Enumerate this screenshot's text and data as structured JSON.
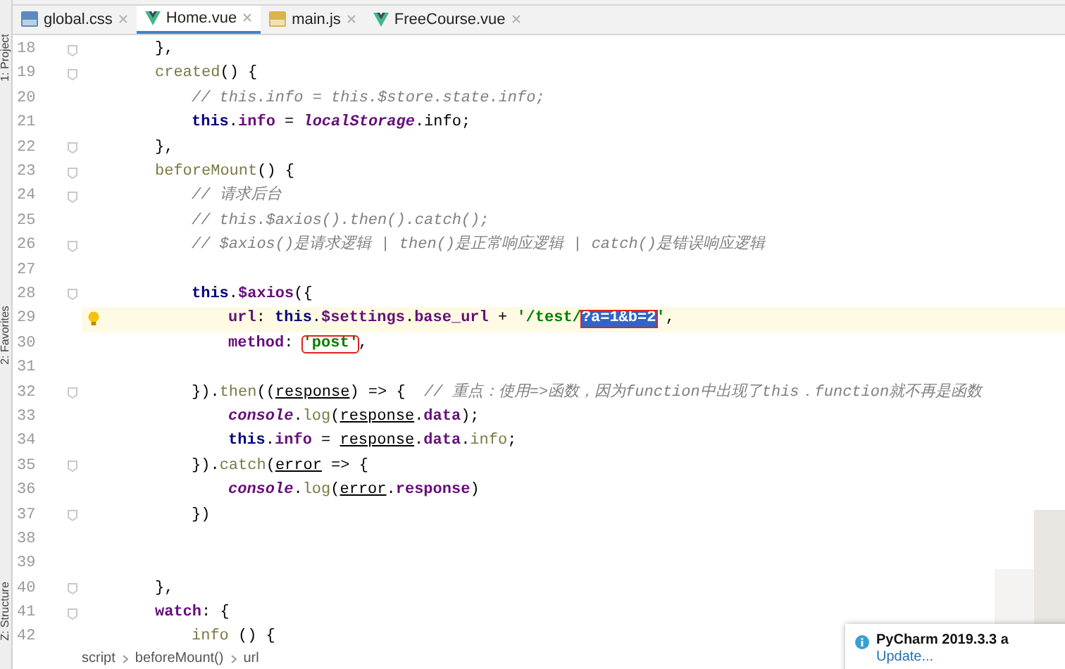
{
  "side_strip": {
    "labels": [
      "1: Project",
      "2: Favorites",
      "Z: Structure"
    ]
  },
  "tabs": [
    {
      "label": "global.css",
      "kind": "css",
      "selected": false
    },
    {
      "label": "Home.vue",
      "kind": "vue",
      "selected": true
    },
    {
      "label": "main.js",
      "kind": "js",
      "selected": false
    },
    {
      "label": "FreeCourse.vue",
      "kind": "vue",
      "selected": false
    }
  ],
  "code_lines": [
    {
      "number": "18",
      "kind": "member",
      "fold": true,
      "current": false,
      "bulb": false,
      "tokens": [
        {
          "text": "},",
          "kind": "plain"
        }
      ]
    },
    {
      "number": "19",
      "kind": "member",
      "fold": true,
      "current": false,
      "bulb": false,
      "tokens": [
        {
          "text": "created",
          "kind": "fn"
        },
        {
          "text": "() {",
          "kind": "plain"
        }
      ]
    },
    {
      "number": "20",
      "kind": "body",
      "fold": false,
      "current": false,
      "bulb": false,
      "tokens": [
        {
          "text": "// this.info = this.$store.state.info;",
          "kind": "comment"
        }
      ]
    },
    {
      "number": "21",
      "kind": "body",
      "fold": false,
      "current": false,
      "bulb": false,
      "tokens": [
        {
          "text": "this",
          "kind": "kw"
        },
        {
          "text": ".",
          "kind": "plain"
        },
        {
          "text": "info",
          "kind": "prop"
        },
        {
          "text": " = ",
          "kind": "plain"
        },
        {
          "text": "localStorage",
          "kind": "global"
        },
        {
          "text": ".info;",
          "kind": "plain"
        }
      ]
    },
    {
      "number": "22",
      "kind": "member",
      "fold": true,
      "current": false,
      "bulb": false,
      "tokens": [
        {
          "text": "},",
          "kind": "plain"
        }
      ]
    },
    {
      "number": "23",
      "kind": "member",
      "fold": true,
      "current": false,
      "bulb": false,
      "tokens": [
        {
          "text": "beforeMount",
          "kind": "fn"
        },
        {
          "text": "() {",
          "kind": "plain"
        }
      ]
    },
    {
      "number": "24",
      "kind": "body",
      "fold": true,
      "current": false,
      "bulb": false,
      "tokens": [
        {
          "text": "// 请求后台",
          "kind": "comment"
        }
      ]
    },
    {
      "number": "25",
      "kind": "body",
      "fold": false,
      "current": false,
      "bulb": false,
      "tokens": [
        {
          "text": "// this.$axios().then().catch();",
          "kind": "comment"
        }
      ]
    },
    {
      "number": "26",
      "kind": "body",
      "fold": true,
      "current": false,
      "bulb": false,
      "tokens": [
        {
          "text": "// $axios()是请求逻辑 | then()是正常响应逻辑 | catch()是错误响应逻辑",
          "kind": "comment"
        }
      ]
    },
    {
      "number": "27",
      "kind": "body",
      "fold": false,
      "current": false,
      "bulb": false
    },
    {
      "number": "28",
      "kind": "body",
      "fold": true,
      "current": false,
      "bulb": false,
      "tokens": [
        {
          "text": "this",
          "kind": "kw"
        },
        {
          "text": ".",
          "kind": "plain"
        },
        {
          "text": "$axios",
          "kind": "prop"
        },
        {
          "text": "({",
          "kind": "plain"
        }
      ]
    },
    {
      "number": "29",
      "kind": "inner",
      "fold": false,
      "current": true,
      "bulb": true,
      "tokens": [
        {
          "text": "url",
          "kind": "prop"
        },
        {
          "text": ": ",
          "kind": "plain"
        },
        {
          "text": "this",
          "kind": "kw"
        },
        {
          "text": ".",
          "kind": "plain"
        },
        {
          "text": "$settings",
          "kind": "prop"
        },
        {
          "text": ".",
          "kind": "plain"
        },
        {
          "text": "base_url",
          "kind": "prop"
        },
        {
          "text": " + ",
          "kind": "plain"
        },
        {
          "text": "'/test/",
          "kind": "str"
        },
        {
          "text": "?a=1&b=2",
          "kind": "selected"
        },
        {
          "text": "'",
          "kind": "str"
        },
        {
          "text": ",",
          "kind": "plain"
        }
      ]
    },
    {
      "number": "30",
      "kind": "inner",
      "fold": false,
      "current": false,
      "bulb": false,
      "tokens": [
        {
          "text": "method",
          "kind": "prop"
        },
        {
          "text": ": ",
          "kind": "plain"
        },
        {
          "text": "'post'",
          "kind": "boxed"
        },
        {
          "text": ",",
          "kind": "plain"
        }
      ]
    },
    {
      "number": "31",
      "kind": "body",
      "fold": false,
      "current": false,
      "bulb": false
    },
    {
      "number": "32",
      "kind": "body",
      "fold": true,
      "current": false,
      "bulb": false,
      "tokens": [
        {
          "text": "}).",
          "kind": "plain"
        },
        {
          "text": "then",
          "kind": "fn"
        },
        {
          "text": "((",
          "kind": "plain"
        },
        {
          "text": "response",
          "kind": "param"
        },
        {
          "text": ") => {  ",
          "kind": "plain"
        },
        {
          "text": "// 重点：使用=>函数，因为function中出现了this．function就不再是函数",
          "kind": "comment"
        }
      ]
    },
    {
      "number": "33",
      "kind": "inner",
      "fold": false,
      "current": false,
      "bulb": false,
      "tokens": [
        {
          "text": "console",
          "kind": "global"
        },
        {
          "text": ".",
          "kind": "plain"
        },
        {
          "text": "log",
          "kind": "fn"
        },
        {
          "text": "(",
          "kind": "plain"
        },
        {
          "text": "response",
          "kind": "param"
        },
        {
          "text": ".",
          "kind": "plain"
        },
        {
          "text": "data",
          "kind": "prop"
        },
        {
          "text": ");",
          "kind": "plain"
        }
      ]
    },
    {
      "number": "34",
      "kind": "inner",
      "fold": false,
      "current": false,
      "bulb": false,
      "tokens": [
        {
          "text": "this",
          "kind": "kw"
        },
        {
          "text": ".",
          "kind": "plain"
        },
        {
          "text": "info",
          "kind": "prop"
        },
        {
          "text": " = ",
          "kind": "plain"
        },
        {
          "text": "response",
          "kind": "param"
        },
        {
          "text": ".",
          "kind": "plain"
        },
        {
          "text": "data",
          "kind": "prop"
        },
        {
          "text": ".",
          "kind": "plain"
        },
        {
          "text": "info",
          "kind": "fn"
        },
        {
          "text": ";",
          "kind": "plain"
        }
      ]
    },
    {
      "number": "35",
      "kind": "body",
      "fold": true,
      "current": false,
      "bulb": false,
      "tokens": [
        {
          "text": "}).",
          "kind": "plain"
        },
        {
          "text": "catch",
          "kind": "fn"
        },
        {
          "text": "(",
          "kind": "plain"
        },
        {
          "text": "error",
          "kind": "param"
        },
        {
          "text": " => {",
          "kind": "plain"
        }
      ]
    },
    {
      "number": "36",
      "kind": "inner",
      "fold": false,
      "current": false,
      "bulb": false,
      "tokens": [
        {
          "text": "console",
          "kind": "global"
        },
        {
          "text": ".",
          "kind": "plain"
        },
        {
          "text": "log",
          "kind": "fn"
        },
        {
          "text": "(",
          "kind": "plain"
        },
        {
          "text": "error",
          "kind": "param"
        },
        {
          "text": ".",
          "kind": "plain"
        },
        {
          "text": "response",
          "kind": "prop"
        },
        {
          "text": ")",
          "kind": "plain"
        }
      ]
    },
    {
      "number": "37",
      "kind": "body",
      "fold": true,
      "current": false,
      "bulb": false,
      "tokens": [
        {
          "text": "})",
          "kind": "plain"
        }
      ]
    },
    {
      "number": "38",
      "kind": "body",
      "fold": false,
      "current": false,
      "bulb": false
    },
    {
      "number": "39",
      "kind": "body",
      "fold": false,
      "current": false,
      "bulb": false
    },
    {
      "number": "40",
      "kind": "member",
      "fold": true,
      "current": false,
      "bulb": false,
      "tokens": [
        {
          "text": "},",
          "kind": "plain"
        }
      ]
    },
    {
      "number": "41",
      "kind": "member",
      "fold": true,
      "current": false,
      "bulb": false,
      "tokens": [
        {
          "text": "watch",
          "kind": "prop"
        },
        {
          "text": ": {",
          "kind": "plain"
        }
      ]
    },
    {
      "number": "42",
      "kind": "body",
      "fold": false,
      "current": false,
      "bulb": false,
      "tokens": [
        {
          "text": "info",
          "kind": "fn"
        },
        {
          "text": " () {",
          "kind": "plain"
        }
      ]
    }
  ],
  "breadcrumb": [
    "script",
    "beforeMount()",
    "url"
  ],
  "notification": {
    "title": "PyCharm 2019.3.3 a",
    "link": "Update..."
  }
}
